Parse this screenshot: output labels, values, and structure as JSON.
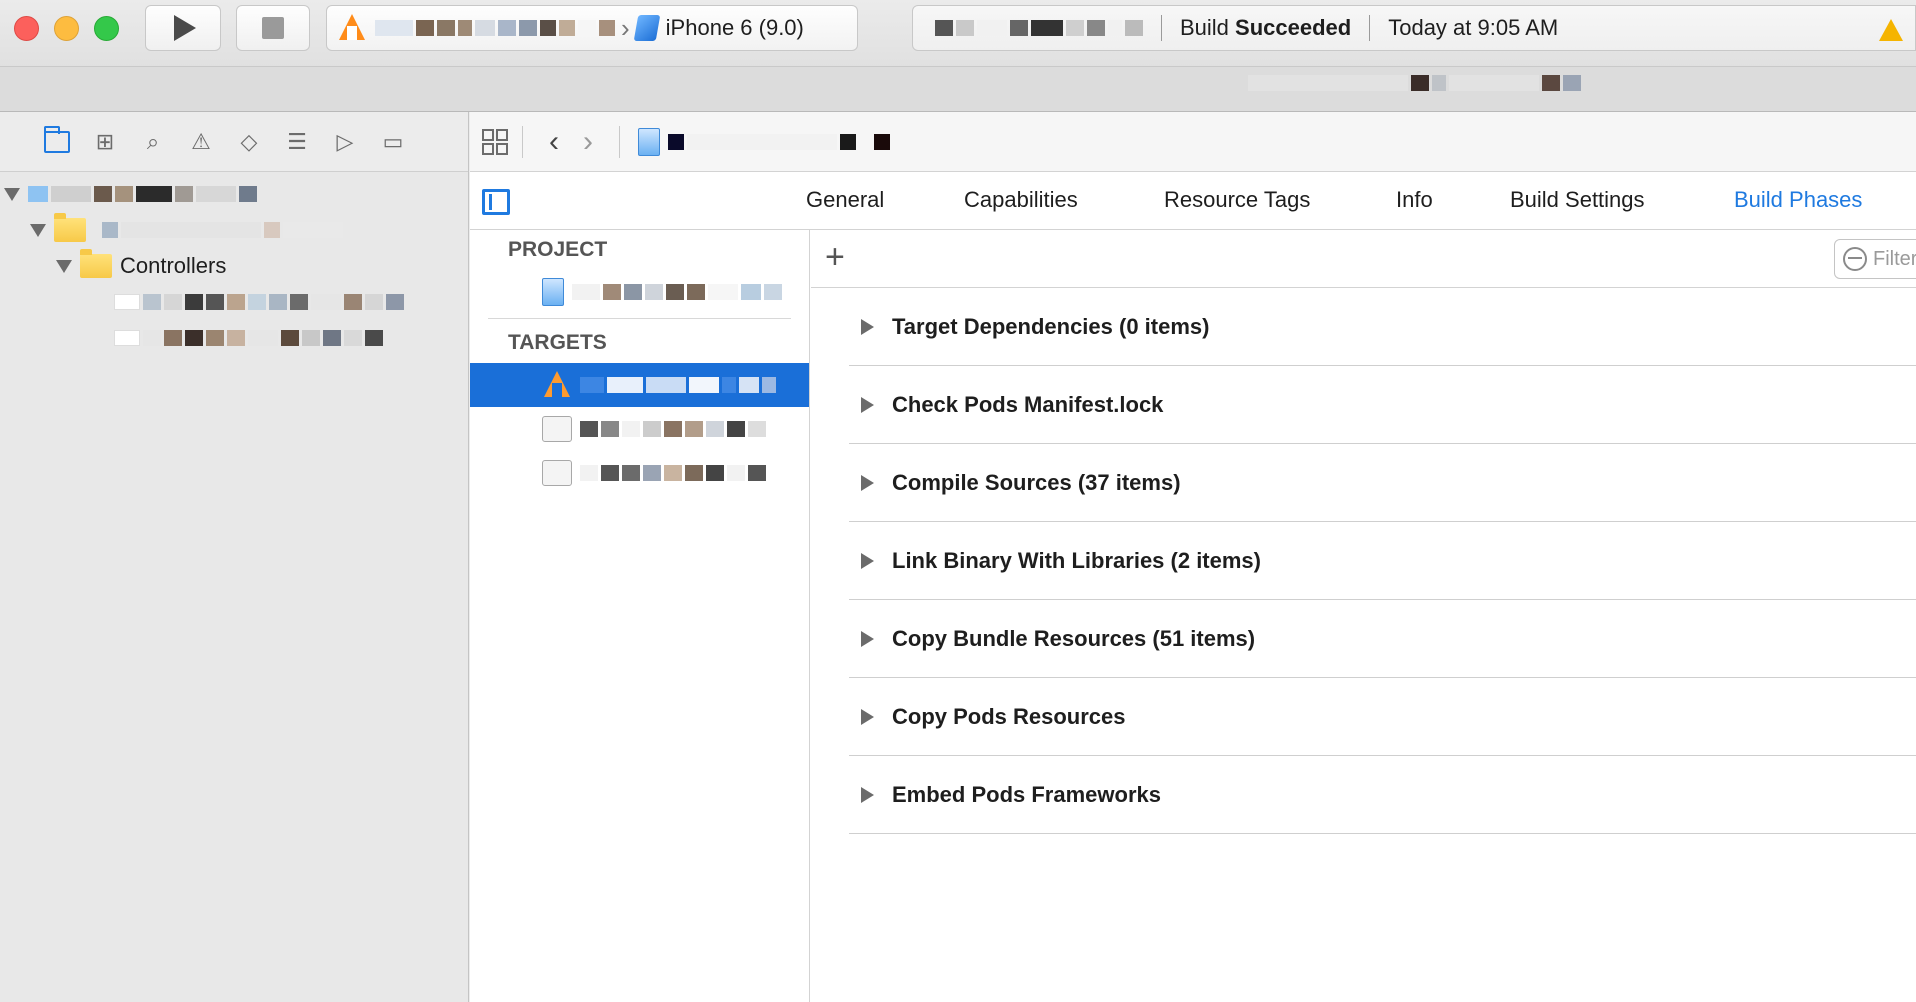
{
  "toolbar": {
    "scheme_device": "iPhone 6 (9.0)",
    "status_prefix": "Build ",
    "status_bold": "Succeeded",
    "status_time": "Today at 9:05 AM"
  },
  "navigator": {
    "folder_controllers": "Controllers"
  },
  "editor": {
    "tabs": [
      "General",
      "Capabilities",
      "Resource Tags",
      "Info",
      "Build Settings",
      "Build Phases"
    ],
    "active_tab": "Build Phases",
    "project_header": "PROJECT",
    "targets_header": "TARGETS",
    "filter_placeholder": "Filter",
    "phases": [
      "Target Dependencies (0 items)",
      "Check Pods Manifest.lock",
      "Compile Sources (37 items)",
      "Link Binary With Libraries (2 items)",
      "Copy Bundle Resources (51 items)",
      "Copy Pods Resources",
      "Embed Pods Frameworks"
    ]
  },
  "colors": {
    "accent": "#1f7ae0",
    "selection": "#1a6fd8",
    "warning": "#f5b400"
  }
}
